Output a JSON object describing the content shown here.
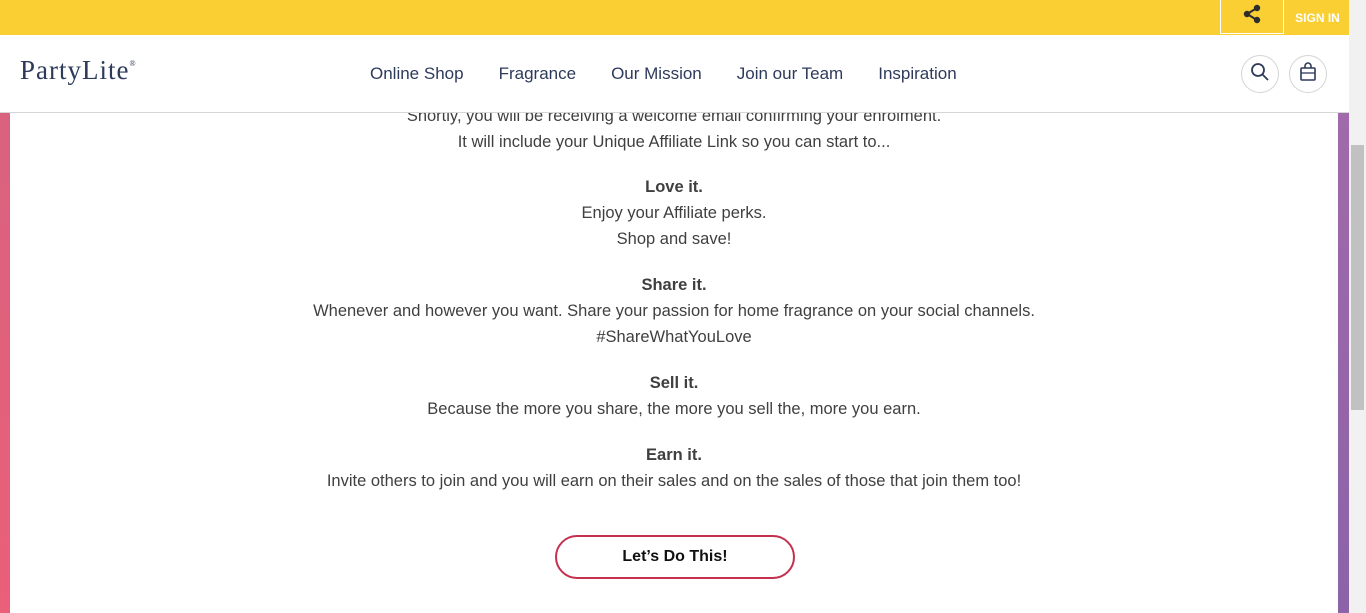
{
  "topbar": {
    "signin_label": "SIGN IN"
  },
  "header": {
    "logo": "PartyLite",
    "logo_mark": "®",
    "nav": [
      "Online Shop",
      "Fragrance",
      "Our Mission",
      "Join our Team",
      "Inspiration"
    ]
  },
  "content": {
    "intro": [
      "Shortly, you will be receiving a welcome email confirming your enrolment.",
      "It will include your Unique Affiliate Link so you can start to..."
    ],
    "sections": [
      {
        "heading": "Love it.",
        "lines": [
          "Enjoy your Affiliate perks.",
          "Shop and save!"
        ]
      },
      {
        "heading": "Share it.",
        "lines": [
          "Whenever and however you want. Share your passion for home fragrance on your social channels.",
          "#ShareWhatYouLove"
        ]
      },
      {
        "heading": "Sell it.",
        "lines": [
          "Because the more you share, the more you sell the, more you earn."
        ]
      },
      {
        "heading": "Earn it.",
        "lines": [
          "Invite others to join and you will earn on their sales and on the sales of those that join them too!"
        ]
      }
    ],
    "cta_label": "Let’s Do This!"
  },
  "colors": {
    "topbar": "#f9cf33",
    "brand": "#2d3a5a",
    "cta_border": "#c4314f"
  },
  "icons": [
    "share-icon",
    "search-icon",
    "shopping-bag-icon"
  ]
}
